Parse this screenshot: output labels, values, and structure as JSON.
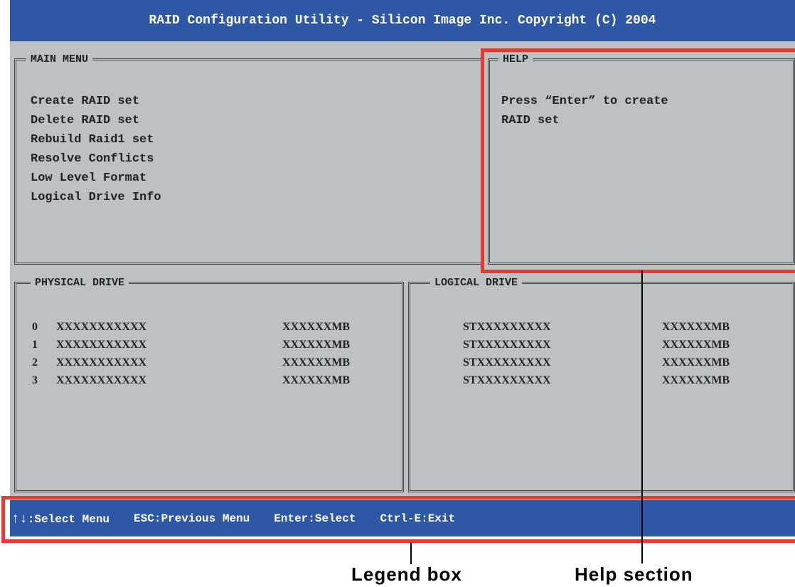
{
  "title": "RAID Configuration Utility - Silicon Image Inc. Copyright (C) 2004",
  "main_menu": {
    "title": "MAIN MENU",
    "items": [
      "Create RAID set",
      "Delete RAID set",
      "Rebuild Raid1 set",
      "Resolve Conflicts",
      "Low Level Format",
      "Logical Drive Info"
    ]
  },
  "help": {
    "title": "HELP",
    "line1": "Press “Enter” to create",
    "line2": "RAID set"
  },
  "physical_drive": {
    "title": "PHYSICAL DRIVE",
    "rows": [
      {
        "index": "0",
        "name": "XXXXXXXXXXX",
        "size": "XXXXXXMB"
      },
      {
        "index": "1",
        "name": "XXXXXXXXXXX",
        "size": "XXXXXXMB"
      },
      {
        "index": "2",
        "name": "XXXXXXXXXXX",
        "size": "XXXXXXMB"
      },
      {
        "index": "3",
        "name": "XXXXXXXXXXX",
        "size": "XXXXXXMB"
      }
    ]
  },
  "logical_drive": {
    "title": "LOGICAL DRIVE",
    "rows": [
      {
        "name": "STXXXXXXXXX",
        "size": "XXXXXXMB"
      },
      {
        "name": "STXXXXXXXXX",
        "size": "XXXXXXMB"
      },
      {
        "name": "STXXXXXXXXX",
        "size": "XXXXXXMB"
      },
      {
        "name": "STXXXXXXXXX",
        "size": "XXXXXXMB"
      }
    ]
  },
  "legend": {
    "arrows": "↑↓",
    "select_menu": ":Select Menu",
    "previous_menu": "ESC:Previous Menu",
    "select": "Enter:Select",
    "exit": "Ctrl-E:Exit"
  },
  "callouts": {
    "legend_box": "Legend box",
    "help_section": "Help section"
  },
  "colors": {
    "bar": "#2e57a6",
    "screen": "#bfc0c3",
    "highlight": "#e53935"
  }
}
